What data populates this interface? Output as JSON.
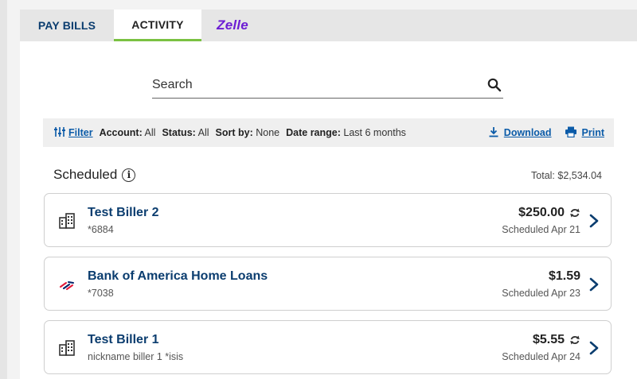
{
  "tabs": {
    "pay_bills": "PAY BILLS",
    "activity": "ACTIVITY",
    "zelle": "Zelle"
  },
  "search": {
    "placeholder": "Search"
  },
  "filter": {
    "link": "Filter",
    "account_label": "Account:",
    "account_value": "All",
    "status_label": "Status:",
    "status_value": "All",
    "sort_label": "Sort by:",
    "sort_value": "None",
    "date_label": "Date range:",
    "date_value": "Last 6 months",
    "download": "Download",
    "print": "Print"
  },
  "scheduled": {
    "title": "Scheduled",
    "total": "Total: $2,534.04"
  },
  "billers": [
    {
      "name": "Test Biller 2",
      "account": "*6884",
      "amount": "$250.00",
      "scheduled": "Scheduled Apr 21",
      "icon": "building-icon",
      "recurring": true
    },
    {
      "name": "Bank of America Home Loans",
      "account": "*7038",
      "amount": "$1.59",
      "scheduled": "Scheduled Apr 23",
      "icon": "bank-of-america-logo",
      "recurring": false
    },
    {
      "name": "Test Biller 1",
      "account": "nickname biller 1 *isis",
      "amount": "$5.55",
      "scheduled": "Scheduled Apr 24",
      "icon": "building-icon",
      "recurring": true
    }
  ],
  "colors": {
    "link": "#0b5ba8",
    "navy": "#0b3d6f",
    "tab_underline": "#7ac142",
    "zelle": "#6d1ed4"
  }
}
